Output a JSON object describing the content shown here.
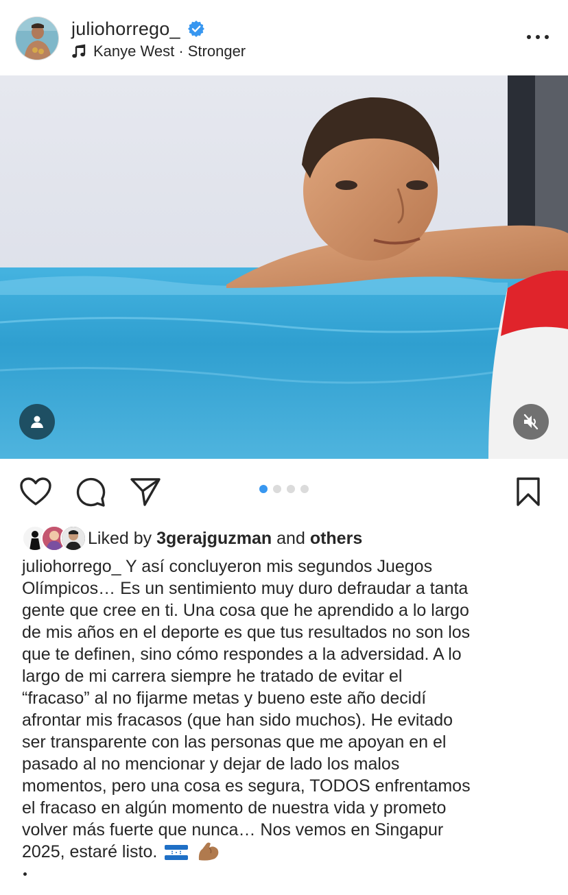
{
  "header": {
    "username": "juliohorrego_",
    "verified": true,
    "audio": "Kanye West · Stronger",
    "avatar_icon": "profile-photo",
    "more_icon": "more-horizontal-icon"
  },
  "media": {
    "tag_icon": "user-tag-icon",
    "mute_icon": "muted-speaker-icon"
  },
  "actions": {
    "like_icon": "heart-icon",
    "comment_icon": "comment-icon",
    "share_icon": "send-icon",
    "save_icon": "bookmark-icon",
    "carousel_total": 4,
    "carousel_active": 1
  },
  "likes": {
    "prefix": "Liked by",
    "user": "3gerajguzman",
    "conjunction": "and",
    "others": "others"
  },
  "caption": {
    "username": "juliohorrego_",
    "first_line_rest": "Y así concluyeron mis segundos Juegos",
    "lines": [
      "Olímpicos… Es un sentimiento muy duro defraudar a tanta",
      "gente que cree en ti. Una cosa que he aprendido a lo largo",
      "de mis años en el deporte es que tus resultados no son los",
      "que te definen, sino cómo respondes a la adversidad. A lo",
      "largo de mi carrera siempre he tratado de evitar el",
      "“fracaso” al no fijarme metas y bueno este año decidí",
      "afrontar mis fracasos (que han sido muchos). He evitado",
      "ser transparente con las personas que me apoyan en el",
      "pasado al no mencionar y dejar de lado los malos",
      "momentos, pero una cosa es segura, TODOS enfrentamos",
      "el fracaso en algún momento de nuestra vida y prometo",
      "volver más fuerte que nunca… Nos vemos en Singapur"
    ],
    "last_line": "2025, estaré listo.",
    "emojis": [
      "honduras-flag-icon",
      "flexed-biceps-icon"
    ]
  },
  "colors": {
    "text": "#262626",
    "verified_blue": "#3897f0",
    "pool_blue": "#2f9fd0",
    "lane_red": "#e0242b"
  }
}
